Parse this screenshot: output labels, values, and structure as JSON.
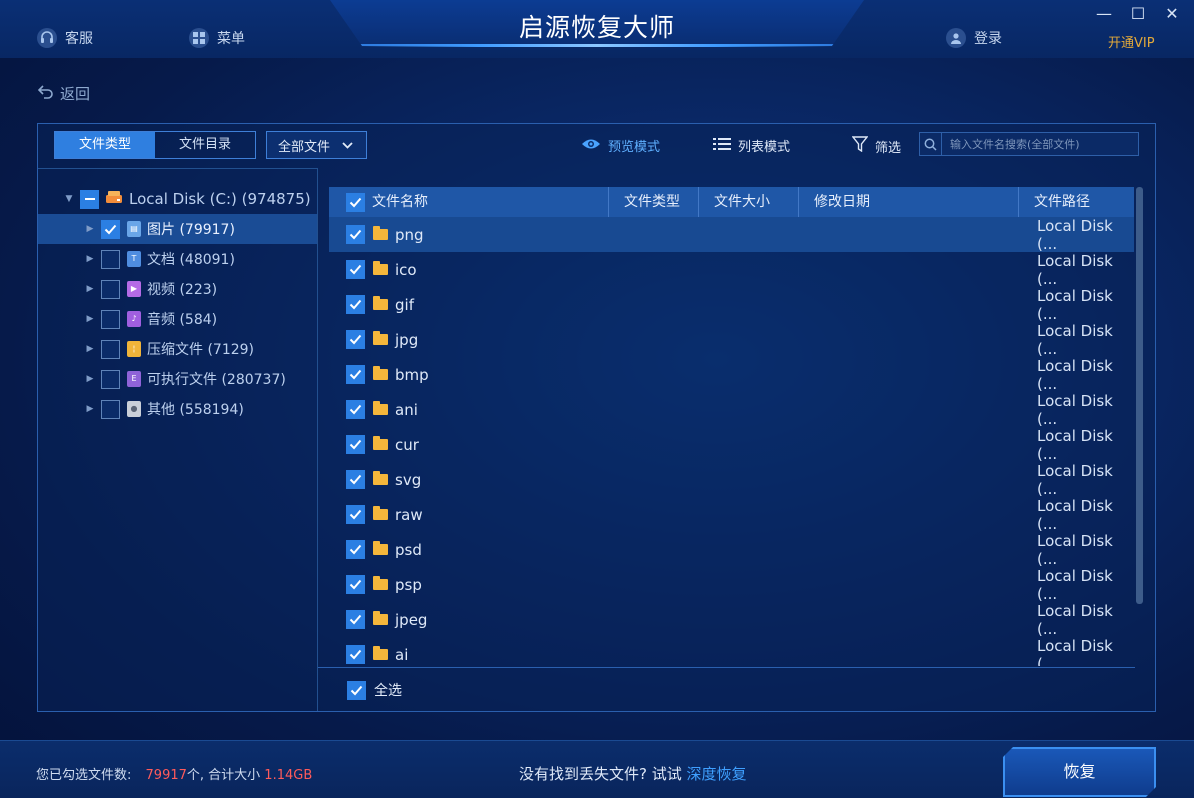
{
  "app": {
    "title": "启源恢复大师"
  },
  "titlebar": {
    "service_label": "客服",
    "menu_label": "菜单",
    "login_label": "登录",
    "vip_label": "开通VIP",
    "minimize": "—",
    "maximize": "☐",
    "close": "✕"
  },
  "nav": {
    "back_label": "返回"
  },
  "toolbar": {
    "tabs": [
      {
        "label": "文件类型",
        "active": true
      },
      {
        "label": "文件目录",
        "active": false
      }
    ],
    "filter_select": "全部文件",
    "preview_mode": "预览模式",
    "list_mode": "列表模式",
    "filter_label": "筛选",
    "search_placeholder": "输入文件名搜索(全部文件)"
  },
  "tree": {
    "root": {
      "label": "Local Disk (C:) (974875)",
      "checked": "partial"
    },
    "items": [
      {
        "label": "图片 (79917)",
        "checked": true,
        "icon": "image-icon",
        "color": "#6aa6e8",
        "selected": true
      },
      {
        "label": "文档 (48091)",
        "checked": false,
        "icon": "document-icon",
        "color": "#4f8de0"
      },
      {
        "label": "视频 (223)",
        "checked": false,
        "icon": "video-icon",
        "color": "#b56be6"
      },
      {
        "label": "音频 (584)",
        "checked": false,
        "icon": "audio-icon",
        "color": "#a05fe0"
      },
      {
        "label": "压缩文件 (7129)",
        "checked": false,
        "icon": "archive-icon",
        "color": "#f0b43a"
      },
      {
        "label": "可执行文件 (280737)",
        "checked": false,
        "icon": "executable-icon",
        "color": "#8f63d8"
      },
      {
        "label": "其他 (558194)",
        "checked": false,
        "icon": "other-file-icon",
        "color": "#c9cfd8"
      }
    ]
  },
  "table": {
    "columns": [
      "文件名称",
      "文件类型",
      "文件大小",
      "修改日期",
      "文件路径"
    ],
    "rows": [
      {
        "name": "png",
        "path": "Local Disk (..."
      },
      {
        "name": "ico",
        "path": "Local Disk (..."
      },
      {
        "name": "gif",
        "path": "Local Disk (..."
      },
      {
        "name": "jpg",
        "path": "Local Disk (..."
      },
      {
        "name": "bmp",
        "path": "Local Disk (..."
      },
      {
        "name": "ani",
        "path": "Local Disk (..."
      },
      {
        "name": "cur",
        "path": "Local Disk (..."
      },
      {
        "name": "svg",
        "path": "Local Disk (..."
      },
      {
        "name": "raw",
        "path": "Local Disk (..."
      },
      {
        "name": "psd",
        "path": "Local Disk (..."
      },
      {
        "name": "psp",
        "path": "Local Disk (..."
      },
      {
        "name": "jpeg",
        "path": "Local Disk (..."
      },
      {
        "name": "ai",
        "path": "Local Disk (..."
      }
    ],
    "select_all_label": "全选"
  },
  "status": {
    "selected_prefix": "您已勾选文件数:",
    "selected_count": "79917",
    "count_suffix": "个, 合计大小",
    "total_size": "1.14GB",
    "hint_text": "没有找到丢失文件? 试试",
    "deep_recovery": "深度恢复",
    "recover_button": "恢复"
  },
  "colors": {
    "accent": "#2f7fe0",
    "vip": "#e3a93a",
    "highlight_red": "#ff5b5b",
    "link": "#3fa0ff"
  }
}
